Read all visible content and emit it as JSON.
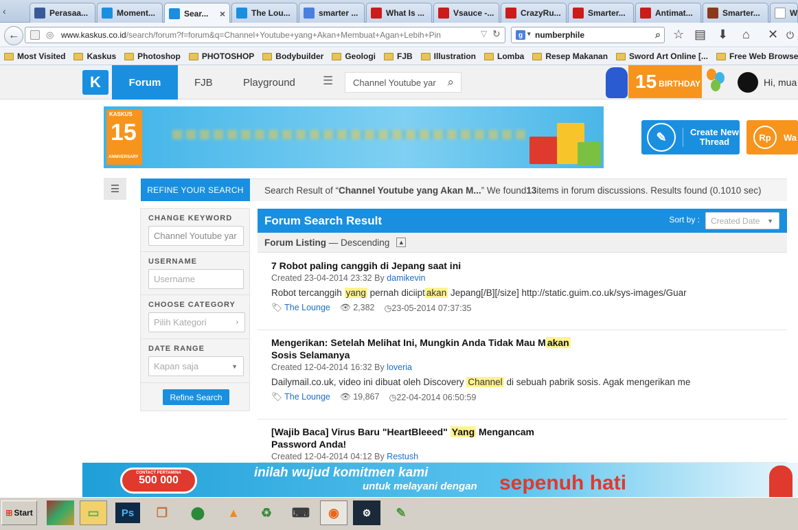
{
  "browser": {
    "tabs": [
      {
        "label": "Perasaa...",
        "icon": "facebook-icon",
        "color": "#3b5998"
      },
      {
        "label": "Moment...",
        "icon": "kaskus-icon",
        "color": "#1a8fe0"
      },
      {
        "label": "Sear...",
        "icon": "kaskus-icon",
        "color": "#1a8fe0",
        "active": true
      },
      {
        "label": "The Lou...",
        "icon": "kaskus-icon",
        "color": "#1a8fe0"
      },
      {
        "label": "smarter ...",
        "icon": "google-icon",
        "color": "#4a7fe0"
      },
      {
        "label": "What Is ...",
        "icon": "youtube-icon",
        "color": "#cc1b1b"
      },
      {
        "label": "Vsauce -...",
        "icon": "youtube-icon",
        "color": "#cc1b1b"
      },
      {
        "label": "CrazyRu...",
        "icon": "youtube-icon",
        "color": "#cc1b1b"
      },
      {
        "label": "Smarter...",
        "icon": "youtube-icon",
        "color": "#cc1b1b"
      },
      {
        "label": "Antimat...",
        "icon": "youtube-icon",
        "color": "#cc1b1b"
      },
      {
        "label": "Smarter...",
        "icon": "smarter-icon",
        "color": "#8a3a1a"
      },
      {
        "label": "W",
        "icon": "wikipedia-icon",
        "color": "#ffffff"
      }
    ],
    "url_domain": "www.kaskus.co.id",
    "url_path": "/search/forum?f=forum&q=Channel+Youtube+yang+Akan+Membuat+Agan+Lebih+Pin",
    "search_value": "numberphile",
    "bookmarks": [
      "Most Visited",
      "Kaskus",
      "Photoshop",
      "PHOTOSHOP",
      "Bodybuilder",
      "Geologi",
      "FJB",
      "Illustration",
      "Lomba",
      "Resep Makanan",
      "Sword Art Online [...",
      "Free Web Browser...",
      "e"
    ]
  },
  "header": {
    "nav": [
      "Forum",
      "FJB",
      "Playground"
    ],
    "search_value": "Channel Youtube yar",
    "birthday_label": "15",
    "birthday_text": "BIRTHDAY",
    "greeting": "Hi, mua"
  },
  "banner": {
    "anniv_number": "15",
    "anniv_label": "ANNIVERSARY",
    "brand": "KASKUS"
  },
  "actions": {
    "create_thread_line1": "Create New",
    "create_thread_line2": "Thread",
    "second_btn": "Wa",
    "rp_icon": "Rp"
  },
  "refine": {
    "tab_label": "REFINE YOUR SEARCH",
    "keyword_label": "CHANGE KEYWORD",
    "keyword_value": "Channel Youtube yar",
    "username_label": "USERNAME",
    "username_placeholder": "Username",
    "category_label": "CHOOSE CATEGORY",
    "category_placeholder": "Pilih Kategori",
    "date_label": "DATE RANGE",
    "date_value": "Kapan saja",
    "button": "Refine Search"
  },
  "result_info": {
    "prefix": "Search Result of “",
    "query": "Channel Youtube yang Akan M...",
    "mid": "” We found ",
    "count": "13",
    "suffix": " items in forum discussions. Results found (0.1010 sec)"
  },
  "results": {
    "title": "Forum Search Result",
    "sort_label": "Sort by :",
    "sort_value": "Created Date",
    "listing_label": "Forum Listing",
    "listing_order": "— Descending",
    "items": [
      {
        "title_a": "7 Robot paling canggih di Jepang saat ini",
        "title_hl": "",
        "title_b": "",
        "created": "Created 23-04-2014 23:32 By ",
        "author": "damikevin",
        "snippet": [
          [
            "Robot tercanggih ",
            false
          ],
          [
            "yang",
            true
          ],
          [
            " pernah diciipt",
            false
          ],
          [
            "akan",
            true
          ],
          [
            " Jepang[/B][/size] http://static.guim.co.uk/sys-images/Guar",
            false
          ]
        ],
        "category": "The Lounge",
        "views": "2,382",
        "last": "23-05-2014 07:37:35"
      },
      {
        "title_a": "Mengerikan: Setelah Melihat Ini, Mungkin Anda Tidak Mau M",
        "title_hl": "akan",
        "title_b": " Sosis Selamanya",
        "created": "Created 12-04-2014 16:32 By ",
        "author": "loveria",
        "snippet": [
          [
            "Dailymail.co.uk, video ini dibuat oleh Discovery ",
            false
          ],
          [
            "Channel",
            true
          ],
          [
            " di sebuah pabrik sosis. Agak mengerikan me",
            false
          ]
        ],
        "category": "The Lounge",
        "views": "19,867",
        "last": "22-04-2014 06:50:59"
      },
      {
        "title_a": "[Wajib Baca] Virus Baru \"HeartBleeed\" ",
        "title_hl": "Yang",
        "title_b": " Mengancam Password Anda!",
        "created": "Created 12-04-2014 04:12 By ",
        "author": "Restush"
      }
    ]
  },
  "bottom_ad": {
    "contact_label": "CONTACT PERTAMINA",
    "contact_number": "500 000",
    "line1": "inilah wujud komitmen kami",
    "line2": "untuk melayani dengan",
    "line3": "sepenuh hati"
  },
  "taskbar": {
    "start_label": "Start"
  },
  "colors": {
    "brand": "#1a8fe0",
    "highlight": "#fff38c",
    "orange": "#f7941d"
  }
}
